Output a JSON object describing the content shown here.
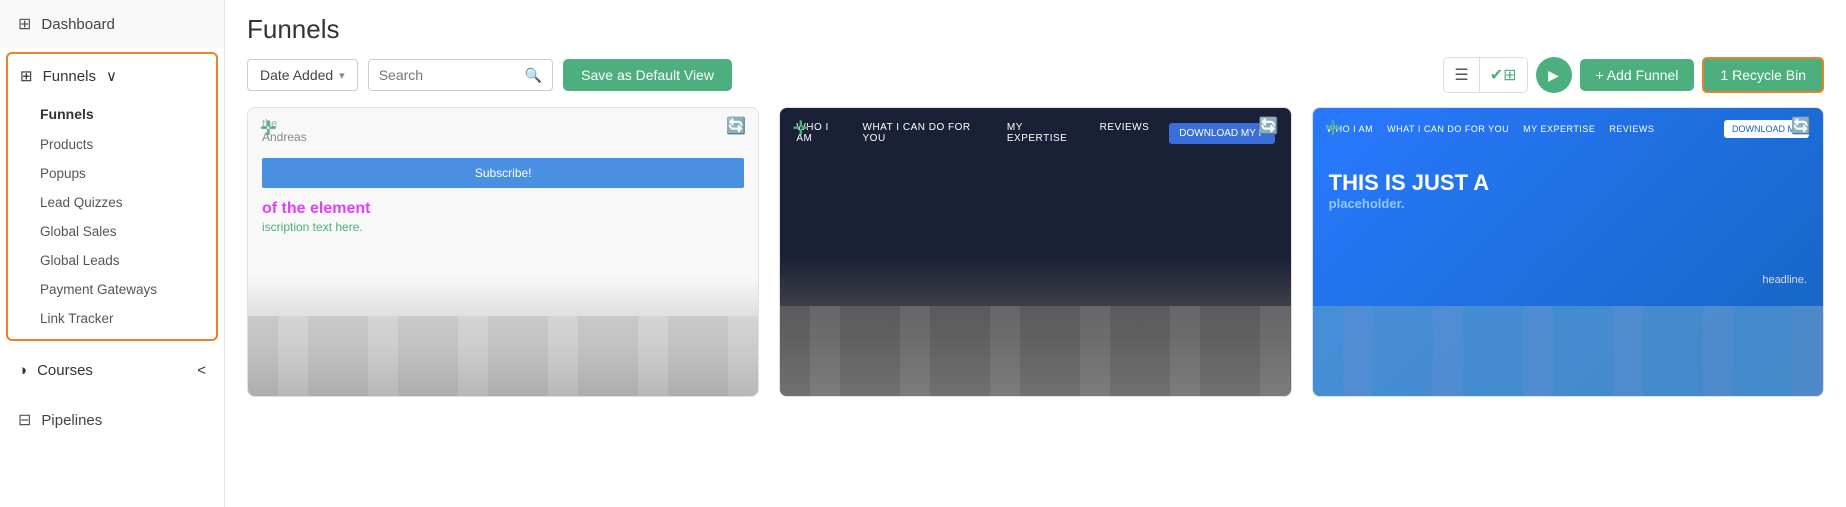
{
  "sidebar": {
    "dashboard": {
      "label": "Dashboard",
      "icon": "⊞"
    },
    "funnels_section": {
      "label": "Funnels",
      "icon": "⊞",
      "arrow": "∨",
      "active": true,
      "sub_items": [
        {
          "label": "Funnels",
          "active": true
        },
        {
          "label": "Products"
        },
        {
          "label": "Popups"
        },
        {
          "label": "Lead Quizzes"
        },
        {
          "label": "Global Sales"
        },
        {
          "label": "Global Leads"
        },
        {
          "label": "Payment Gateways"
        },
        {
          "label": "Link Tracker"
        }
      ]
    },
    "courses": {
      "label": "Courses",
      "icon": "◑",
      "arrow": "<"
    },
    "pipelines": {
      "label": "Pipelines",
      "icon": "⊟"
    }
  },
  "header": {
    "title": "Funnels"
  },
  "toolbar": {
    "filter_label": "Date Added",
    "filter_arrow": "▾",
    "search_placeholder": "Search",
    "save_default_view": "Save as Default View",
    "add_funnel": "+ Add Funnel",
    "recycle_bin": "🗑 Recycle Bin",
    "recycle_bin_count": "1 Recycle Bin"
  },
  "cards": [
    {
      "id": 1,
      "top_label": "the",
      "name_label": "Andreas",
      "subscribe_text": "Subscribe!",
      "heading": "of the element",
      "desc": "iscription text here."
    },
    {
      "id": 2,
      "nav_links": [
        "WHO I AM",
        "WHAT I CAN DO FOR YOU",
        "MY EXPERTISE",
        "REVIEWS"
      ],
      "nav_btn": "DOWNLOAD MY F"
    },
    {
      "id": 3,
      "nav_links": [
        "WHO I AM",
        "WHAT I CAN DO FOR YOU",
        "MY EXPERTISE",
        "REVIEWS"
      ],
      "nav_btn": "DOWNLOAD MY",
      "heading": "THIS IS JUST A",
      "sub": "placeholder.",
      "bottom_text": "headline."
    }
  ]
}
